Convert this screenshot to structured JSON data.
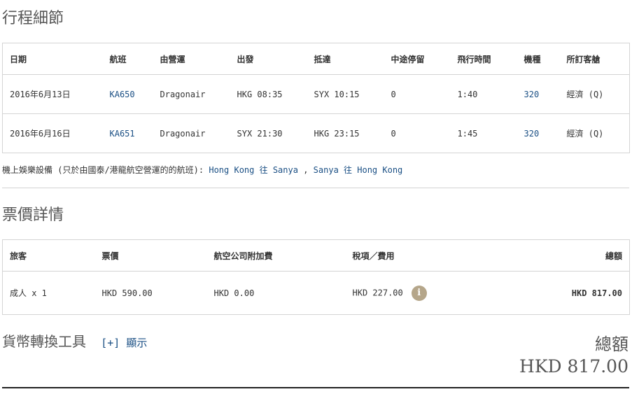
{
  "itinerary": {
    "title": "行程細節",
    "headers": [
      "日期",
      "航班",
      "由營運",
      "出發",
      "抵達",
      "中途停留",
      "飛行時間",
      "機種",
      "所訂客艙"
    ],
    "rows": [
      {
        "date": "2016年6月13日",
        "flight": "KA650",
        "operator": "Dragonair",
        "depart": "HKG 08:35",
        "arrive": "SYX 10:15",
        "stops": "0",
        "duration": "1:40",
        "aircraft": "320",
        "cabin": "經濟 (Q)"
      },
      {
        "date": "2016年6月16日",
        "flight": "KA651",
        "operator": "Dragonair",
        "depart": "SYX 21:30",
        "arrive": "HKG 23:15",
        "stops": "0",
        "duration": "1:45",
        "aircraft": "320",
        "cabin": "經濟 (Q)"
      }
    ]
  },
  "entertainment": {
    "label": "機上娛樂設備 (只於由國泰/港龍航空營運的的航班):",
    "link1": "Hong Kong 往 Sanya",
    "separator": ",",
    "link2": "Sanya 往 Hong Kong"
  },
  "fare": {
    "title": "票價詳情",
    "headers": [
      "旅客",
      "票價",
      "航空公司附加費",
      "稅項／費用",
      "總額"
    ],
    "row": {
      "passenger": "成人 x 1",
      "fare": "HKD 590.00",
      "surcharge": "HKD 0.00",
      "taxes": "HKD 227.00",
      "total": "HKD 817.00"
    },
    "info_icon": "info-icon",
    "accent_color": "#b5a68a"
  },
  "converter": {
    "title": "貨幣轉換工具",
    "toggle": "[+] 顯示"
  },
  "total": {
    "label": "總額",
    "value": "HKD 817.00"
  },
  "link_color": "#1a4f84"
}
